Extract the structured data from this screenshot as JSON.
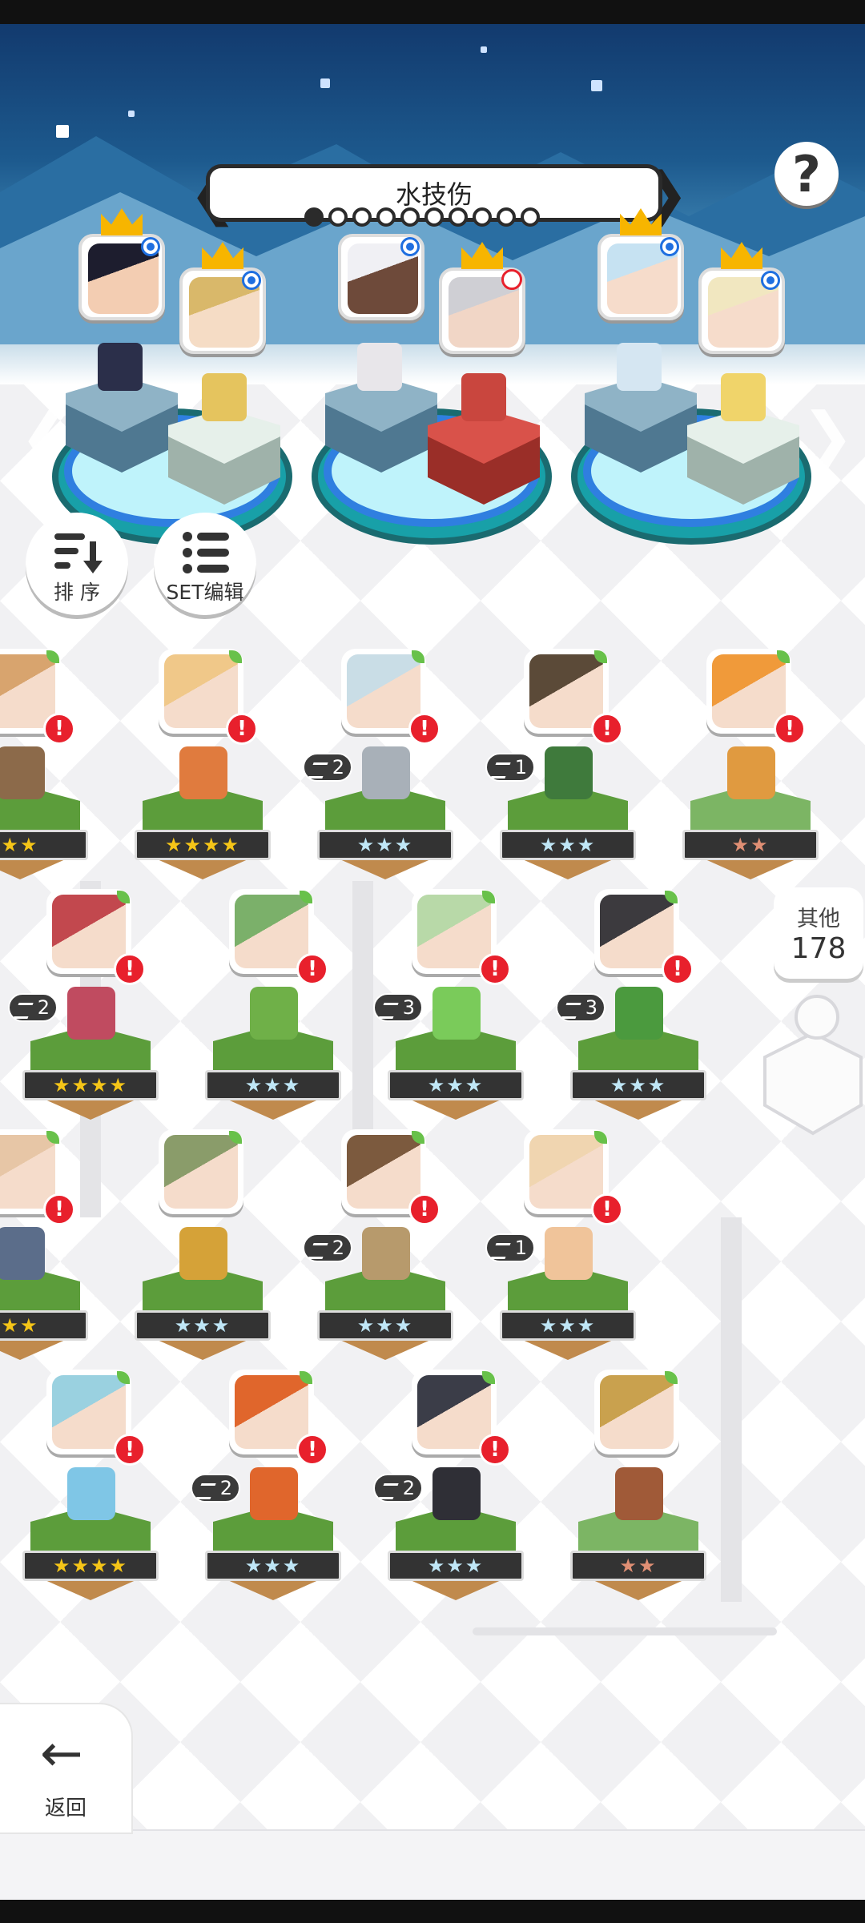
{
  "formation": {
    "title": "水技伤",
    "page_count": 10,
    "active_page": 1,
    "help_label": "?"
  },
  "buttons": {
    "sort_label": "排 序",
    "set_edit_label": "SET编辑",
    "back_label": "返回"
  },
  "others": {
    "label": "其他",
    "count": "178"
  },
  "unit_rows": [
    [
      {
        "rank": "★★",
        "rank_tier": "gold",
        "skill": null,
        "alert": true
      },
      {
        "rank": "★★★★",
        "rank_tier": "gold",
        "skill": null,
        "alert": true
      },
      {
        "rank": "★★★",
        "rank_tier": "silver",
        "skill": "2",
        "alert": true
      },
      {
        "rank": "★★★",
        "rank_tier": "silver",
        "skill": "1",
        "alert": true
      },
      {
        "rank": "★★",
        "rank_tier": "bronze",
        "skill": null,
        "alert": true
      }
    ],
    [
      {
        "rank": "★★★★",
        "rank_tier": "gold",
        "skill": "2",
        "alert": true
      },
      {
        "rank": "★★★",
        "rank_tier": "silver",
        "skill": null,
        "alert": true
      },
      {
        "rank": "★★★",
        "rank_tier": "silver",
        "skill": "3",
        "alert": true
      },
      {
        "rank": "★★★",
        "rank_tier": "silver",
        "skill": "3",
        "alert": true
      }
    ],
    [
      {
        "rank": "★★",
        "rank_tier": "gold",
        "skill": null,
        "alert": true
      },
      {
        "rank": "★★★",
        "rank_tier": "silver",
        "skill": null,
        "alert": false
      },
      {
        "rank": "★★★",
        "rank_tier": "silver",
        "skill": "2",
        "alert": true
      },
      {
        "rank": "★★★",
        "rank_tier": "silver",
        "skill": "1",
        "alert": true
      }
    ],
    [
      {
        "rank": "★★★★",
        "rank_tier": "gold",
        "skill": null,
        "alert": true
      },
      {
        "rank": "★★★",
        "rank_tier": "silver",
        "skill": "2",
        "alert": true
      },
      {
        "rank": "★★★",
        "rank_tier": "silver",
        "skill": "2",
        "alert": true
      },
      {
        "rank": "★★",
        "rank_tier": "bronze",
        "skill": null,
        "alert": false
      }
    ]
  ],
  "alert_glyph": "!",
  "colors": {
    "accent_blue": "#2f7fe0",
    "alert_red": "#e8202c",
    "grass": "#5c9d3b",
    "crown": "#f7b500"
  }
}
